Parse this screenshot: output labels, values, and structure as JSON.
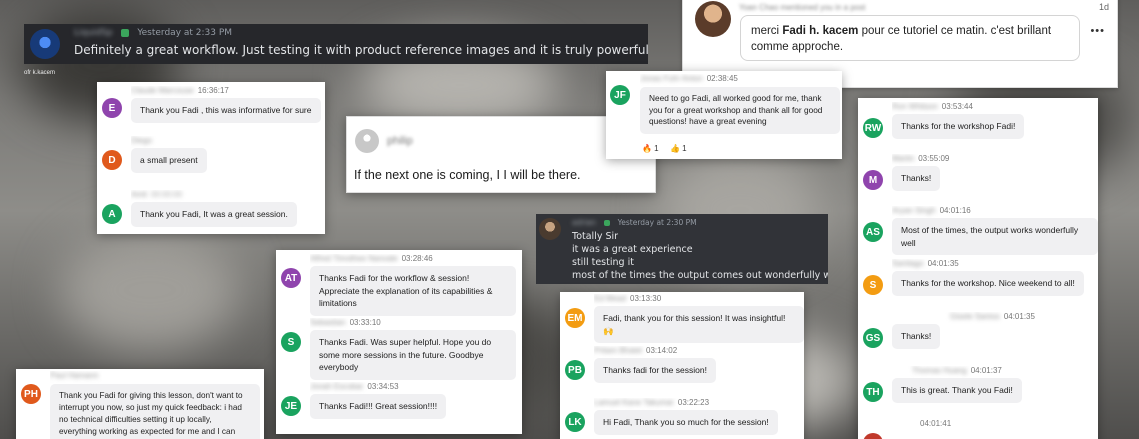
{
  "discord_top": {
    "time": "Yesterday at 2:33 PM",
    "text": "Definitely a great workflow. Just testing it with product reference images and it is truly powerful.",
    "video_caption": "ofr k.kacem"
  },
  "linkedin": {
    "age": "1d",
    "header": "Yoan Chao mentioned you in a post",
    "text_before": "merci ",
    "mention": "Fadi h. kacem",
    "text_after": " pour ce tutoriel ce matin. c'est brillant comme approche.",
    "more": "•••"
  },
  "card_left": {
    "messages": [
      {
        "initials": "E",
        "color": "#8f44ad",
        "sender": "Claude Marcouse",
        "time": "16:36:17",
        "text": "Thank you Fadi , this was informative for sure"
      },
      {
        "initials": "D",
        "color": "#e0591c",
        "sender": "Diego",
        "time": "",
        "text": "a small present"
      },
      {
        "initials": "A",
        "color": "#1aa35f",
        "sender": "Amit",
        "time": "",
        "text": "Thank you Fadi, It was a great session."
      }
    ]
  },
  "philip": {
    "name": "philip",
    "text": "If the next one is coming, I I will be there."
  },
  "card_jf": {
    "initials": "JF",
    "color": "#1aa35f",
    "sender": "Jonas Fuhr Anton",
    "time": "02:38:45",
    "text": "Need to go Fadi, all worked good for me, thank you for a great workshop and thank all for good questions! have a great evening",
    "reaction1": "🔥 1",
    "reaction2": "👍 1"
  },
  "card_right": {
    "messages": [
      {
        "initials": "RW",
        "color": "#1aa35f",
        "sender": "Ron Whitson",
        "time": "03:53:44",
        "text": "Thanks for the workshop Fadi!"
      },
      {
        "initials": "M",
        "color": "#8f44ad",
        "sender": "Martin",
        "time": "03:55:09",
        "text": "Thanks!"
      },
      {
        "initials": "AS",
        "color": "#1aa35f",
        "sender": "Aryan Singh",
        "time": "04:01:16",
        "text": "Most of the times, the output works wonderfully well"
      },
      {
        "initials": "S",
        "color": "#f39c12",
        "sender": "Santiago",
        "time": "04:01:35",
        "text": "Thanks for the workshop. Nice weekend to all!"
      },
      {
        "initials": "GS",
        "color": "#1aa35f",
        "sender": "Gisele Santos",
        "time": "04:01:35",
        "text": "Thanks!"
      },
      {
        "initials": "TH",
        "color": "#1aa35f",
        "sender": "Thomas Huang",
        "time": "04:01:37",
        "text": "This is great. Thank you Fadi!"
      },
      {
        "initials": "",
        "color": "#c0392b",
        "sender": "",
        "time": "04:01:41",
        "text": ""
      }
    ]
  },
  "discord_mid": {
    "time": "Yesterday at 2:30 PM",
    "lines": [
      "Totally Sir",
      "it was a great experience",
      "still testing it",
      "most of the times the output comes out wonderfully well"
    ]
  },
  "card_mid": {
    "messages": [
      {
        "initials": "AT",
        "color": "#8f44ad",
        "sender": "Alfred Timothee Nanvale",
        "time": "03:28:46",
        "text": "Thanks Fadi for the workflow & session! Appreciate the explanation of its capabilities & limitations"
      },
      {
        "initials": "S",
        "color": "#1aa35f",
        "sender": "Sebastian",
        "time": "03:33:10",
        "text": "Thanks Fadi. Was super helpful. Hope you do some more sessions in the future. Goodbye everybody"
      },
      {
        "initials": "JE",
        "color": "#1aa35f",
        "sender": "Jonah Escobar",
        "time": "03:34:53",
        "text": "Thanks Fadi!!! Great session!!!!"
      }
    ]
  },
  "card_em": {
    "messages": [
      {
        "initials": "EM",
        "color": "#f39c12",
        "sender": "Ed Mead",
        "time": "03:13:30",
        "text": "Fadi, thank you for this session! It was insightful! 🙌"
      },
      {
        "initials": "PB",
        "color": "#1aa35f",
        "sender": "Pritam Bhatel",
        "time": "03:14:02",
        "text": "Thanks fadi for the session!"
      },
      {
        "initials": "LK",
        "color": "#1aa35f",
        "sender": "Lamuel Kane Takumar",
        "time": "03:22:23",
        "text": "Hi Fadi, Thank you so much for the session!"
      }
    ]
  },
  "card_ph": {
    "initials": "PH",
    "color": "#e0591c",
    "sender": "Paul Hamann",
    "text": "Thank you Fadi for giving this lesson, don't want to interrupt you now, so just my quick feedback: i had no technical difficulties setting it up locally, everything working as expected for me and I can"
  }
}
